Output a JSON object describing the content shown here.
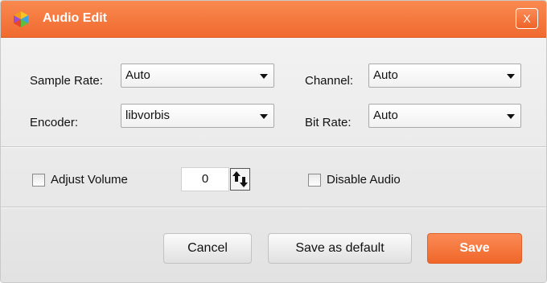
{
  "window": {
    "title": "Audio Edit",
    "close_label": "X"
  },
  "settings": {
    "sample_rate": {
      "label": "Sample Rate:",
      "value": "Auto"
    },
    "channel": {
      "label": "Channel:",
      "value": "Auto"
    },
    "encoder": {
      "label": "Encoder:",
      "value": "libvorbis"
    },
    "bit_rate": {
      "label": "Bit Rate:",
      "value": "Auto"
    }
  },
  "volume": {
    "adjust_label": "Adjust Volume",
    "adjust_checked": false,
    "value": "0",
    "disable_label": "Disable Audio",
    "disable_checked": false
  },
  "buttons": {
    "cancel": "Cancel",
    "save_default": "Save as default",
    "save": "Save"
  },
  "colors": {
    "accent": "#f47a3f",
    "title_text": "#ffffff"
  },
  "icons": {
    "app": "app-logo-icon",
    "close": "close-icon",
    "dropdown": "chevron-down-icon",
    "stepper": "up-down-arrows-icon"
  }
}
